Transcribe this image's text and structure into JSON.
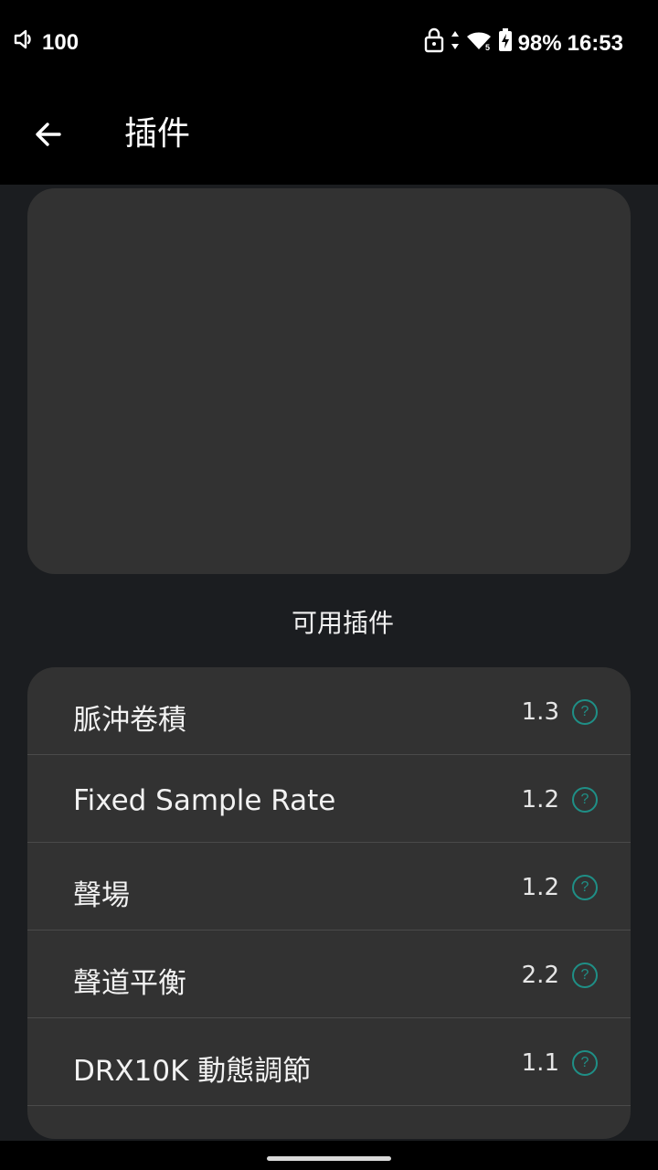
{
  "status_bar": {
    "volume": "100",
    "battery": "98%",
    "time": "16:53",
    "icons": [
      "volume-icon",
      "lock-icon",
      "data-arrows-icon",
      "wifi-icon",
      "battery-charging-icon"
    ]
  },
  "app_bar": {
    "title": "插件"
  },
  "section": {
    "title": "可用插件"
  },
  "plugins": [
    {
      "name": "脈沖卷積",
      "version": "1.3"
    },
    {
      "name": "Fixed Sample Rate",
      "version": "1.2"
    },
    {
      "name": "聲場",
      "version": "1.2"
    },
    {
      "name": "聲道平衡",
      "version": "2.2"
    },
    {
      "name": "DRX10K 動態調節",
      "version": "1.1"
    }
  ],
  "help_symbol": "?",
  "colors": {
    "background": "#1b1d20",
    "card": "#323232",
    "accent": "#1f8f86",
    "bar": "#000000"
  }
}
